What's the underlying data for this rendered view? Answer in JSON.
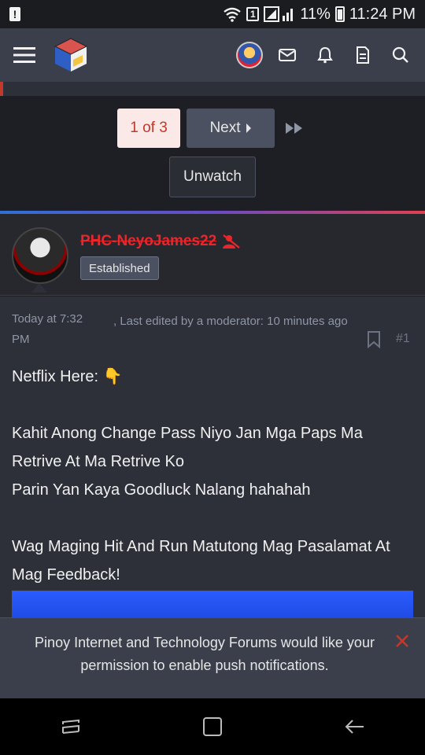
{
  "status_bar": {
    "sim_label": "1",
    "battery_percent": "11%",
    "time": "11:24 PM",
    "icons": [
      "alert-icon",
      "wifi-icon",
      "signal-icon",
      "battery-icon"
    ]
  },
  "header": {
    "icons": [
      "menu-icon",
      "site-logo",
      "user-avatar",
      "mail-icon",
      "bell-icon",
      "document-icon",
      "search-icon"
    ]
  },
  "pagination": {
    "current": "1 of 3",
    "next_label": "Next",
    "last_icon": "fast-forward-icon"
  },
  "thread_actions": {
    "unwatch_label": "Unwatch"
  },
  "post": {
    "username": "PHC-NeyoJames22",
    "user_badge": "Established",
    "date": "Today at 7:32 PM",
    "edited": ", Last edited by a moderator: 10 minutes ago",
    "post_number": "#1",
    "lines": {
      "l1": "Netflix Here: 👇",
      "l2": "Kahit Anong Change Pass Niyo Jan Mga Paps Ma Retrive At Ma Retrive Ko",
      "l3": "Parin Yan Kaya Goodluck Nalang hahahah",
      "l4": "Wag Maging Hit And Run Matutong Mag Pasalamat At Mag Feedback!"
    }
  },
  "push_banner": {
    "message": "Pinoy Internet and Technology Forums would like your permission to enable push notifications.",
    "close_icon": "close-icon"
  },
  "nav_bar": {
    "icons": [
      "recent-apps-icon",
      "home-icon",
      "back-icon"
    ]
  },
  "colors": {
    "header_bg": "#3a3f4b",
    "accent_red": "#c0392b",
    "username_red": "#e8262b",
    "page_bg": "#1e1f24"
  }
}
